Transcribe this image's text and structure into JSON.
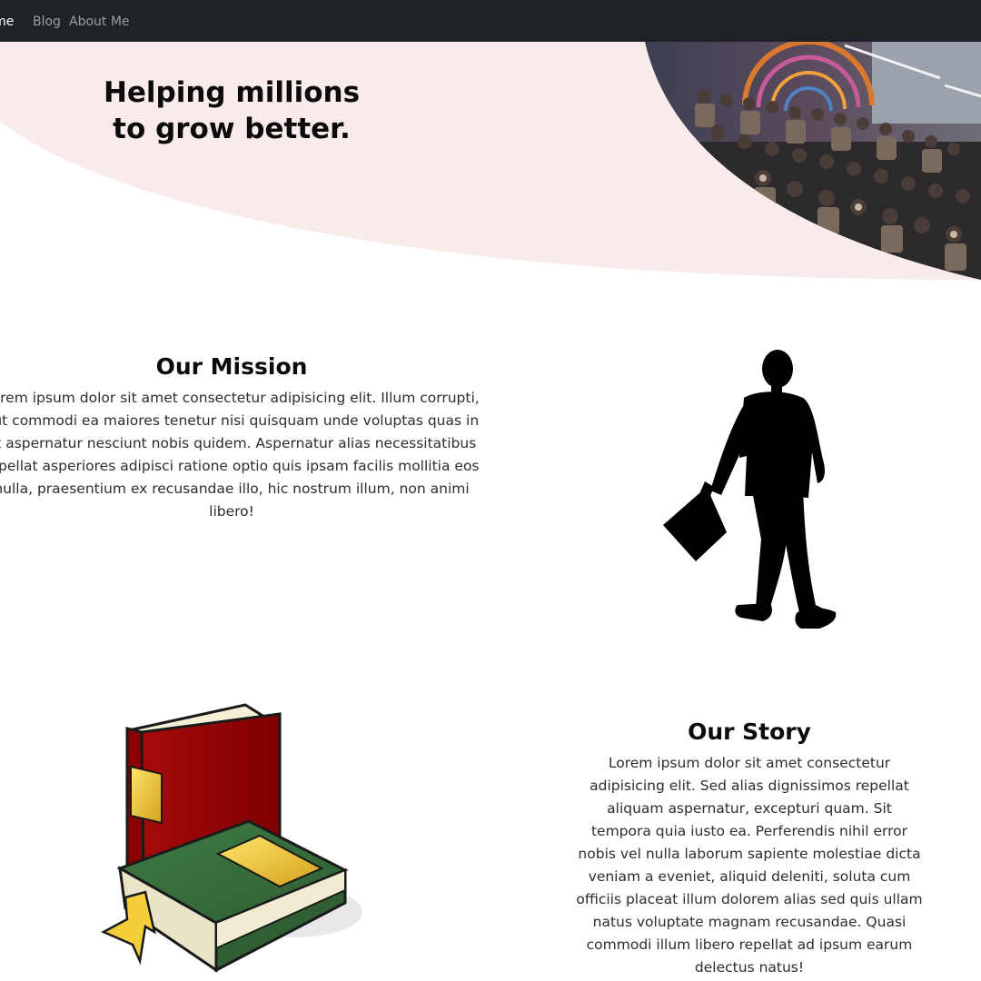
{
  "navbar": {
    "links": [
      {
        "label": "Home",
        "active": true
      },
      {
        "label": "Blog",
        "active": false
      },
      {
        "label": "About Me",
        "active": false
      }
    ]
  },
  "hero": {
    "headline_line1": "Helping millions",
    "headline_line2": "to grow better.",
    "image_subject": "audience seated in a lecture hall",
    "background_color": "#f8ebe9"
  },
  "mission": {
    "title": "Our Mission",
    "text": "Lorem ipsum dolor sit amet consectetur adipisicing elit. Illum corrupti, aut commodi ea maiores tenetur nisi quisquam unde voluptas quas in at aspernatur nesciunt nobis quidem. Aspernatur alias necessitatibus repellat asperiores adipisci ratione optio quis ipsam facilis mollitia eos nulla, praesentium ex recusandae illo, hic nostrum illum, non animi libero!",
    "illustration": "businessman-walking-silhouette"
  },
  "story": {
    "title": "Our Story",
    "text": "Lorem ipsum dolor sit amet consectetur adipisicing elit. Sed alias dignissimos repellat aliquam aspernatur, excepturi quam. Sit tempora quia iusto ea. Perferendis nihil error nobis vel nulla laborum sapiente molestiae dicta veniam a eveniet, aliquid deleniti, soluta cum officiis placeat illum dolorem alias sed quis ullam natus voluptate magnam recusandae. Quasi commodi illum libero repellat ad ipsum earum delectus natus!",
    "illustration": "books-icon"
  },
  "colors": {
    "navbar_bg": "#1f2227",
    "nav_active": "#ffffff",
    "nav_inactive": "#9a9da2",
    "hero_pink": "#f8ebe9"
  }
}
